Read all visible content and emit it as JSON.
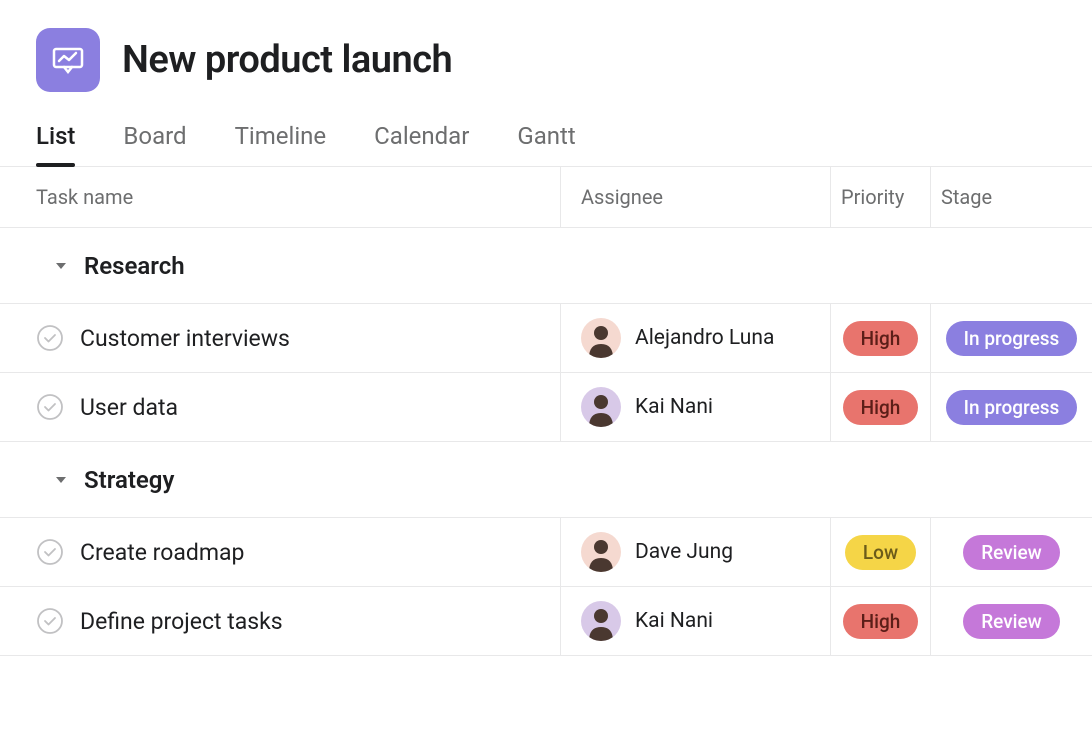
{
  "project": {
    "title": "New product launch",
    "icon": "presentation-chart-icon"
  },
  "tabs": [
    {
      "label": "List",
      "active": true
    },
    {
      "label": "Board",
      "active": false
    },
    {
      "label": "Timeline",
      "active": false
    },
    {
      "label": "Calendar",
      "active": false
    },
    {
      "label": "Gantt",
      "active": false
    }
  ],
  "columns": {
    "task": "Task name",
    "assignee": "Assignee",
    "priority": "Priority",
    "stage": "Stage"
  },
  "sections": [
    {
      "name": "Research",
      "tasks": [
        {
          "name": "Customer interviews",
          "assignee": "Alejandro Luna",
          "avatar_bg": "#f5d9d0",
          "priority": "High",
          "priority_class": "badge-high",
          "stage": "In progress",
          "stage_class": "badge-inprogress"
        },
        {
          "name": "User data",
          "assignee": "Kai Nani",
          "avatar_bg": "#d8c9e8",
          "priority": "High",
          "priority_class": "badge-high",
          "stage": "In progress",
          "stage_class": "badge-inprogress"
        }
      ]
    },
    {
      "name": "Strategy",
      "tasks": [
        {
          "name": "Create roadmap",
          "assignee": "Dave Jung",
          "avatar_bg": "#f5d9d0",
          "priority": "Low",
          "priority_class": "badge-low",
          "stage": "Review",
          "stage_class": "badge-review"
        },
        {
          "name": "Define project tasks",
          "assignee": "Kai Nani",
          "avatar_bg": "#d8c9e8",
          "priority": "High",
          "priority_class": "badge-high",
          "stage": "Review",
          "stage_class": "badge-review"
        }
      ]
    }
  ]
}
